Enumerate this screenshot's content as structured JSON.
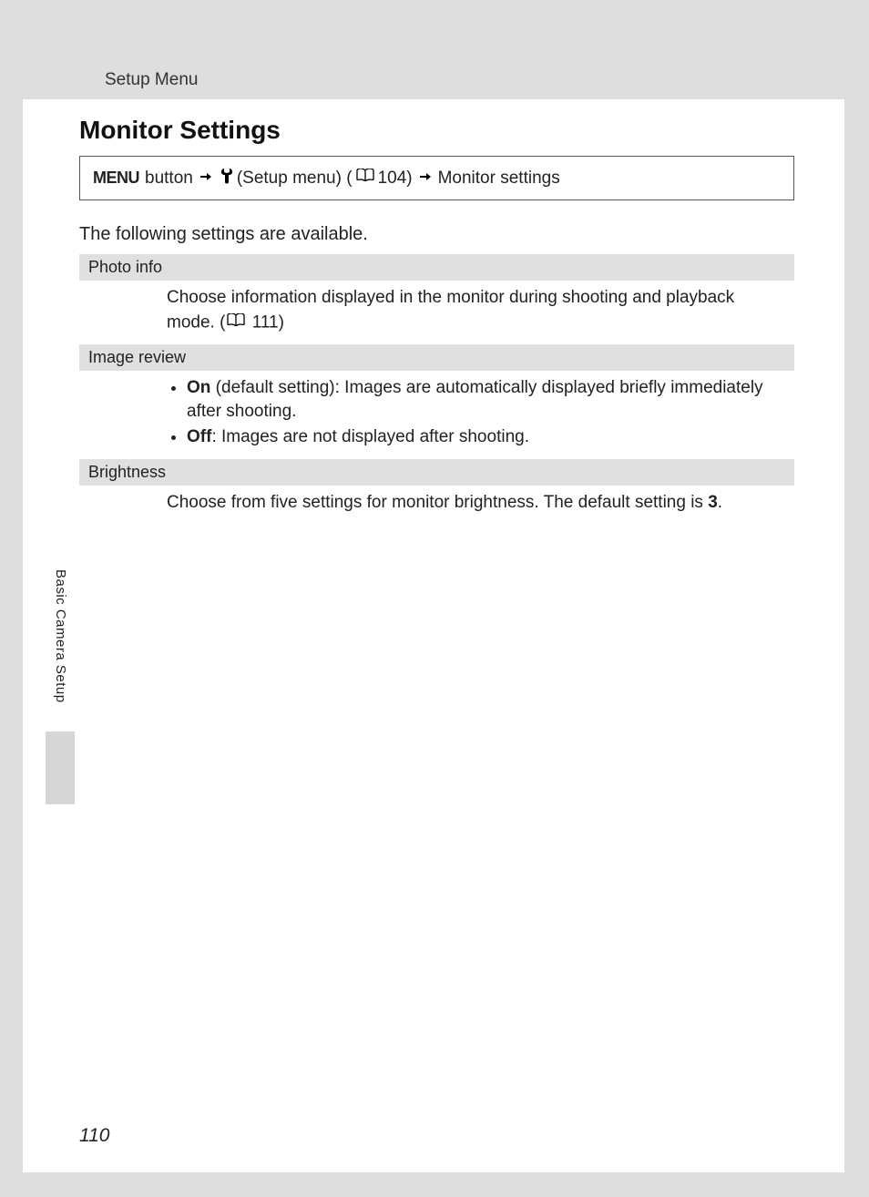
{
  "header": {
    "section": "Setup Menu"
  },
  "title": "Monitor Settings",
  "nav": {
    "menu_label": "MENU",
    "button_text": " button ",
    "setup_menu_text": " (Setup menu) (",
    "page_ref_104": " 104) ",
    "final": " Monitor settings"
  },
  "intro": "The following settings are available.",
  "settings": {
    "photo_info": {
      "label": "Photo info",
      "desc_pre": "Choose information displayed in the monitor during shooting and playback mode. (",
      "desc_ref": " 111)"
    },
    "image_review": {
      "label": "Image review",
      "on_bold": "On",
      "on_text": " (default setting): Images are automatically displayed briefly immediately after shooting.",
      "off_bold": "Off",
      "off_text": ": Images are not displayed after shooting."
    },
    "brightness": {
      "label": "Brightness",
      "desc_pre": "Choose from five settings for monitor brightness. The default setting is ",
      "desc_bold": "3",
      "desc_post": "."
    }
  },
  "side_tab": "Basic Camera Setup",
  "page_number": "110"
}
